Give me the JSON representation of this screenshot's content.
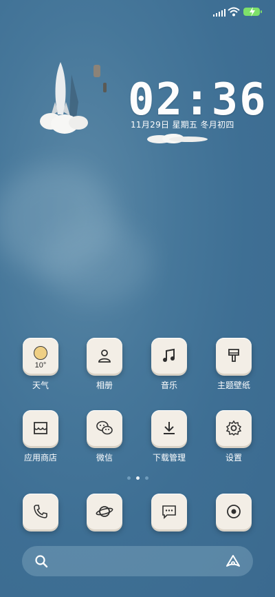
{
  "status_bar": {
    "signal_icon": "signal-icon",
    "wifi_icon": "wifi-icon",
    "battery_icon": "battery-charging-icon",
    "battery_color": "#7ee06a"
  },
  "clock": {
    "time": "02:36",
    "date": "11月29日 星期五 冬月初四"
  },
  "apps_row1": [
    {
      "label": "天气",
      "icon": "weather-icon",
      "temp": "10°"
    },
    {
      "label": "相册",
      "icon": "gallery-person-icon"
    },
    {
      "label": "音乐",
      "icon": "music-note-icon"
    },
    {
      "label": "主题壁纸",
      "icon": "paint-brush-icon"
    }
  ],
  "apps_row2": [
    {
      "label": "应用商店",
      "icon": "store-icon"
    },
    {
      "label": "微信",
      "icon": "wechat-icon"
    },
    {
      "label": "下载管理",
      "icon": "download-icon"
    },
    {
      "label": "设置",
      "icon": "gear-icon"
    }
  ],
  "dock": [
    {
      "icon": "phone-icon"
    },
    {
      "icon": "browser-planet-icon"
    },
    {
      "icon": "messages-icon"
    },
    {
      "icon": "camera-icon"
    }
  ],
  "page_indicator": {
    "count": 3,
    "active": 2
  },
  "search_bar": {
    "left_icon": "search-icon",
    "right_icon": "assistant-icon"
  },
  "colors": {
    "tile": "#f3eee6",
    "background": "#3e6f94",
    "text": "#ffffff"
  }
}
